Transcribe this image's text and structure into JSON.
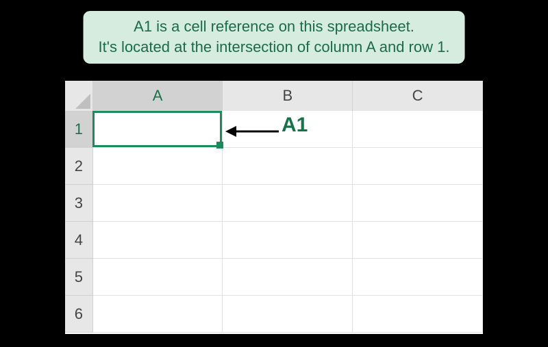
{
  "caption": {
    "line1": "A1 is a cell reference on this spreadsheet.",
    "line2": "It's located at the intersection of column A and row 1."
  },
  "columns": [
    "A",
    "B",
    "C"
  ],
  "rows": [
    "1",
    "2",
    "3",
    "4",
    "5",
    "6"
  ],
  "selected_cell_ref": "A1",
  "selected_col_index": 0,
  "selected_row_index": 0,
  "annotation_label": "A1",
  "colors": {
    "accent": "#157347",
    "selection_border": "#1a8b5d",
    "caption_bg": "#d5ecdf"
  }
}
